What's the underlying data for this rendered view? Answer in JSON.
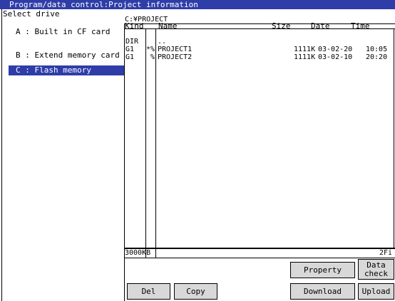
{
  "title": "Program/data control:Project information",
  "drive_panel": {
    "label": "Select drive",
    "items": [
      {
        "label": "A : Built in CF card",
        "selected": false
      },
      {
        "label": "B : Extend memory card",
        "selected": false
      },
      {
        "label": "C : Flash memory",
        "selected": true
      }
    ]
  },
  "path": "C:¥PROJECT",
  "columns": {
    "kind": "Kind",
    "name": "Name",
    "size": "Size",
    "date": "Date",
    "time": "Time"
  },
  "rows": [
    {
      "kind": "DIR",
      "flag": "",
      "name": "..",
      "size": "",
      "date": "",
      "time": ""
    },
    {
      "kind": "G1",
      "flag": "*%",
      "name": "PROJECT1",
      "size": "1111K",
      "date": "03-02-20",
      "time": "10:05"
    },
    {
      "kind": "G1",
      "flag": "%",
      "name": "PROJECT2",
      "size": "1111K",
      "date": "03-02-10",
      "time": "20:20"
    }
  ],
  "footer": {
    "capacity": "3000KB",
    "count": "2Fi"
  },
  "buttons": {
    "property": "Property",
    "data_check_1": "Data",
    "data_check_2": "check",
    "del": "Del",
    "copy": "Copy",
    "download": "Download",
    "upload": "Upload"
  },
  "colors": {
    "title_bar": "#2f3da8",
    "selection": "#2f3da8",
    "button": "#d8d8d8"
  }
}
